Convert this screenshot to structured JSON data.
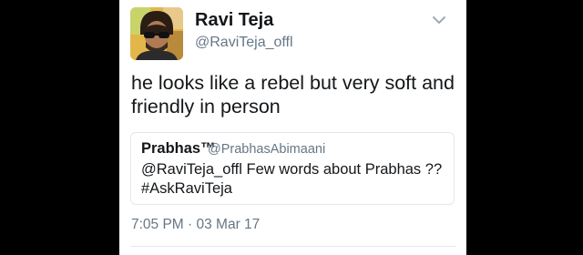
{
  "tweet": {
    "author": {
      "display_name": "Ravi Teja",
      "handle": "@RaviTeja_offl",
      "avatar_icon": "profile-photo"
    },
    "menu_icon": "chevron-down-icon",
    "text_line1": "he looks like a rebel but very soft and",
    "text_line2": "friendly in person",
    "quoted": {
      "display_name": "Prabhas™",
      "handle": "@PrabhasAbimaani",
      "text_line1": "@RaviTeja_offl  Few words about Prabhas ??",
      "text_line2": "#AskRaviTeja"
    },
    "timestamp": "7:05 PM · 03 Mar 17"
  },
  "colors": {
    "background": "#000000",
    "card": "#ffffff",
    "text_primary": "#14171a",
    "text_secondary": "#657786",
    "border": "#e1e8ed"
  }
}
